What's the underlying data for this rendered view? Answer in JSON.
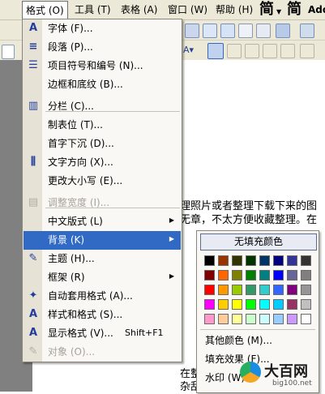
{
  "menubar": {
    "items": [
      {
        "label": "格式 (O)",
        "active": true
      },
      {
        "label": "工具 (T)"
      },
      {
        "label": "表格 (A)"
      },
      {
        "label": "窗口 (W)"
      },
      {
        "label": "帮助 (H)"
      }
    ],
    "ime1": "简",
    "ime2": "简",
    "extra": "Ado"
  },
  "format_menu": {
    "items": [
      {
        "label": "字体 (F)...",
        "icon": "A",
        "name": "font"
      },
      {
        "label": "段落 (P)...",
        "icon": "≡",
        "name": "paragraph"
      },
      {
        "label": "项目符号和编号 (N)...",
        "icon": "☰",
        "name": "bullets-numbering"
      },
      {
        "label": "边框和底纹 (B)...",
        "icon": "",
        "name": "borders-shading"
      },
      {
        "label": "分栏 (C)...",
        "icon": "▥",
        "name": "columns"
      },
      {
        "label": "制表位 (T)...",
        "icon": "",
        "name": "tabs"
      },
      {
        "label": "首字下沉 (D)...",
        "icon": "",
        "name": "drop-cap"
      },
      {
        "label": "文字方向 (X)...",
        "icon": "⫼",
        "name": "text-direction"
      },
      {
        "label": "更改大小写 (E)...",
        "icon": "",
        "name": "change-case"
      },
      {
        "label": "调整宽度 (I)...",
        "icon": "▤",
        "name": "fit-text",
        "disabled": true
      },
      {
        "label": "中文版式 (L)",
        "icon": "",
        "name": "asian-layout",
        "submenu": true
      },
      {
        "label": "背景 (K)",
        "icon": "",
        "name": "background",
        "submenu": true,
        "highlight": true
      },
      {
        "label": "主题 (H)...",
        "icon": "✎",
        "name": "theme"
      },
      {
        "label": "框架 (R)",
        "icon": "",
        "name": "frames",
        "submenu": true
      },
      {
        "label": "自动套用格式 (A)...",
        "icon": "✦",
        "name": "autoformat"
      },
      {
        "label": "样式和格式 (S)...",
        "icon": "A",
        "name": "styles-formatting"
      },
      {
        "label": "显示格式 (V)...",
        "icon": "A",
        "name": "reveal-formatting",
        "shortcut": "Shift+F1"
      },
      {
        "label": "对象 (O)...",
        "icon": "✎",
        "name": "object",
        "disabled": true
      }
    ]
  },
  "background_submenu": {
    "no_fill": "无填充颜色",
    "more_colors": "其他颜色 (M)...",
    "fill_effects": "填充效果 (F)...",
    "watermark": "水印 (W)..."
  },
  "swatch_colors": [
    [
      "#000000",
      "#993300",
      "#333300",
      "#003300",
      "#003366",
      "#000080",
      "#333399",
      "#333333"
    ],
    [
      "#800000",
      "#FF6600",
      "#808000",
      "#008000",
      "#008080",
      "#0000FF",
      "#666699",
      "#808080"
    ],
    [
      "#FF0000",
      "#FF9900",
      "#99CC00",
      "#339966",
      "#33CCCC",
      "#3366FF",
      "#800080",
      "#969696"
    ],
    [
      "#FF00FF",
      "#FFCC00",
      "#FFFF00",
      "#00FF00",
      "#00FFFF",
      "#00CCFF",
      "#993366",
      "#C0C0C0"
    ],
    [
      "#FF99CC",
      "#FFCC99",
      "#FFFF99",
      "#CCFFCC",
      "#CCFFFF",
      "#99CCFF",
      "#CC99FF",
      "#FFFFFF"
    ]
  ],
  "document": {
    "line1": "理照片或者整理下载下来的图",
    "line2": "无章，不太方便收藏整理。在",
    "line3": "在整",
    "line4": "杂乱无章"
  },
  "watermark_logo": {
    "title": "大百网",
    "url": "big100.net"
  }
}
